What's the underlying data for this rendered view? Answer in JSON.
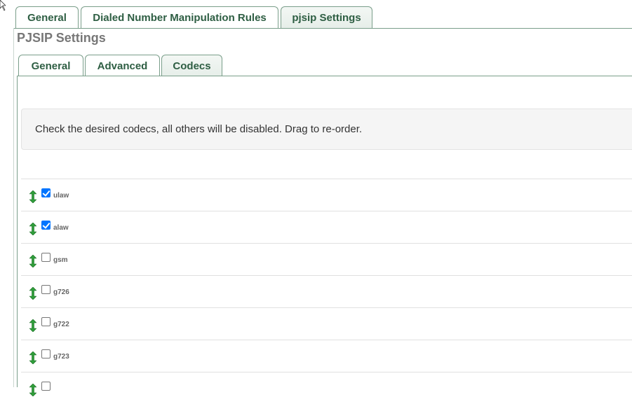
{
  "top_tabs": [
    {
      "label": "General",
      "active": false
    },
    {
      "label": "Dialed Number Manipulation Rules",
      "active": false
    },
    {
      "label": "pjsip Settings",
      "active": true
    }
  ],
  "section_title": "PJSIP Settings",
  "inner_tabs": [
    {
      "label": "General",
      "active": false
    },
    {
      "label": "Advanced",
      "active": false
    },
    {
      "label": "Codecs",
      "active": true
    }
  ],
  "help_text": "Check the desired codecs, all others will be disabled. Drag to re-order.",
  "codecs": [
    {
      "name": "ulaw",
      "checked": true
    },
    {
      "name": "alaw",
      "checked": true
    },
    {
      "name": "gsm",
      "checked": false
    },
    {
      "name": "g726",
      "checked": false
    },
    {
      "name": "g722",
      "checked": false
    },
    {
      "name": "g723",
      "checked": false
    },
    {
      "name": "",
      "checked": false
    }
  ],
  "colors": {
    "tab_text": "#2e5e43",
    "tab_border": "#7a9e8a",
    "drag_icon": "#2f9e3a",
    "checkbox_checked": "#0075ff"
  },
  "icons": {
    "drag": "up-down-arrow-icon",
    "cursor": "mouse-pointer-icon"
  }
}
